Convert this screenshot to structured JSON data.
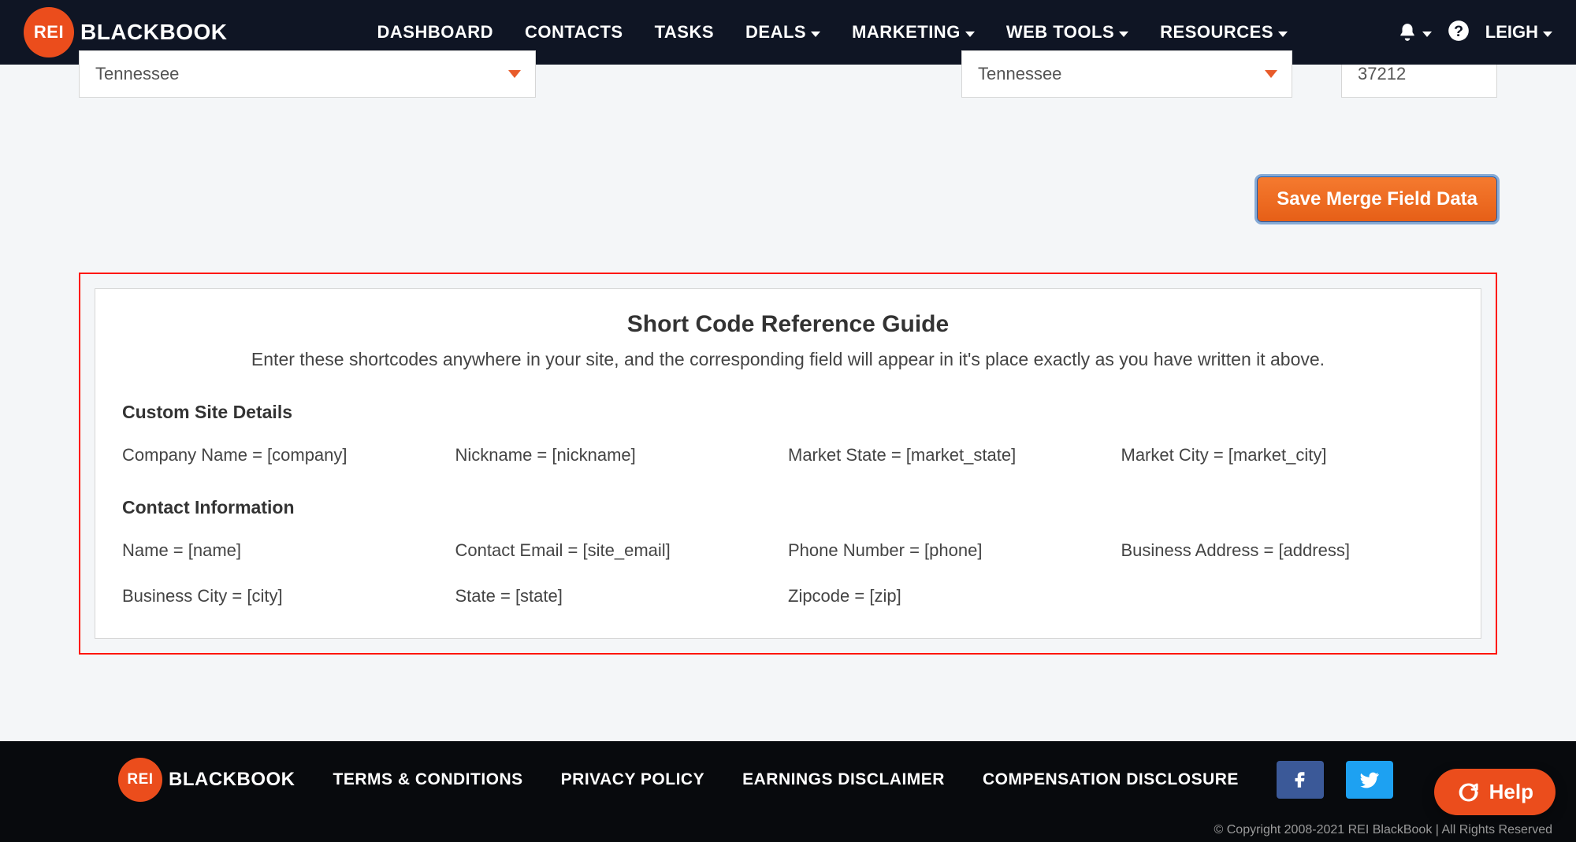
{
  "header": {
    "logo_badge": "REI",
    "logo_text": "BLACKBOOK",
    "nav": {
      "dashboard": "DASHBOARD",
      "contacts": "CONTACTS",
      "tasks": "TASKS",
      "deals": "DEALS",
      "marketing": "MARKETING",
      "web_tools": "WEB TOOLS",
      "resources": "RESOURCES"
    },
    "user_name": "LEIGH"
  },
  "form": {
    "select1_value": "Tennessee",
    "select2_value": "Tennessee",
    "zip_value": "37212"
  },
  "actions": {
    "save_label": "Save Merge Field Data"
  },
  "guide": {
    "title": "Short Code Reference Guide",
    "subtitle": "Enter these shortcodes anywhere in your site, and the corresponding field will appear in it's place exactly as you have written it above.",
    "section1_title": "Custom Site Details",
    "section1": {
      "company": "Company Name = [company]",
      "nickname": "Nickname = [nickname]",
      "market_state": "Market State = [market_state]",
      "market_city": "Market City = [market_city]"
    },
    "section2_title": "Contact Information",
    "section2": {
      "name": "Name = [name]",
      "email": "Contact Email = [site_email]",
      "phone": "Phone Number = [phone]",
      "address": "Business Address = [address]",
      "city": "Business City = [city]",
      "state": "State = [state]",
      "zip": "Zipcode = [zip]"
    }
  },
  "footer": {
    "links": {
      "terms": "TERMS & CONDITIONS",
      "privacy": "PRIVACY POLICY",
      "earnings": "EARNINGS DISCLAIMER",
      "compensation": "COMPENSATION DISCLOSURE"
    },
    "copyright": "© Copyright 2008-2021 REI BlackBook | All Rights Reserved"
  },
  "help_widget": {
    "label": "Help"
  }
}
